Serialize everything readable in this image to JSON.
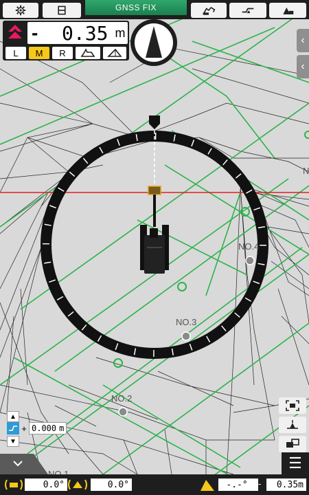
{
  "status": {
    "gnss_label": "GNSS FIX"
  },
  "depth": {
    "sign": "-",
    "value": "0.35",
    "unit": "m"
  },
  "mode_buttons": [
    "L",
    "M",
    "R"
  ],
  "active_mode": "M",
  "offset": {
    "sign": "+",
    "value": "0.000",
    "unit": "m"
  },
  "map_labels": [
    "NO.4",
    "NO.3",
    "NO.2",
    "NO.1",
    "N"
  ],
  "bottom": {
    "roll": "0.0°",
    "pitch": "0.0°",
    "angle": "-.-°",
    "dash": "-",
    "distance": "0.35m"
  },
  "colors": {
    "accent": "#f6c81b",
    "gnss": "#23935b",
    "alert": "#e8195d",
    "design_line": "#2bb34a",
    "reference": "#e21d1d"
  }
}
